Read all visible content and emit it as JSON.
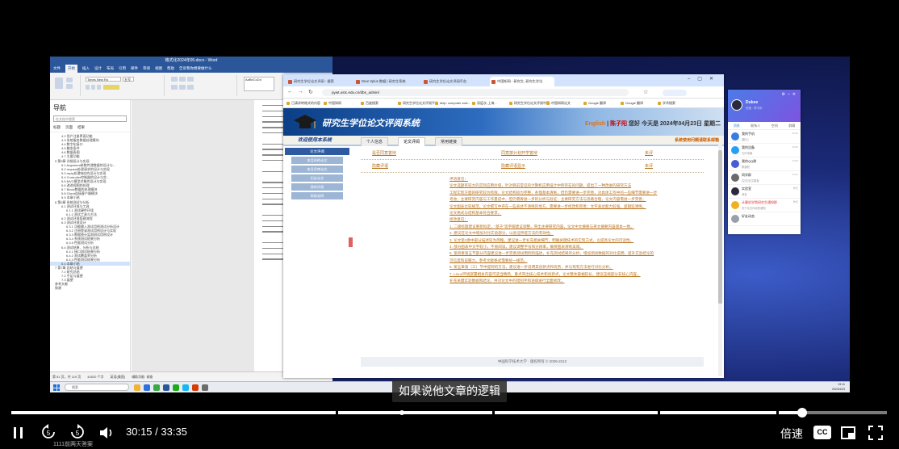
{
  "screen": {
    "word": {
      "title": "格式化2024年05.docx - Word",
      "tabs": [
        "文件",
        "开始",
        "插入",
        "设计",
        "布局",
        "引用",
        "邮件",
        "审阅",
        "视图",
        "帮助",
        "告诉我你想要做什么"
      ],
      "font_name": "Times New Ro",
      "font_size": "五号",
      "style": "AaBbCcDd",
      "nav_title": "导航",
      "nav_search_placeholder": "在文档中搜索",
      "nav_tabs": [
        "标题",
        "页面",
        "结果"
      ],
      "nav_items": [
        "4.2 用户注册界面功能",
        "4.3 系统服务数据处理模块",
        "4.4 数字化接口",
        "4.5 触发条件",
        "4.6 数据表图",
        "4.7 主要功能",
        "5 第5章 详细设计与实现",
        "5.1 Argument参数传递数据的设计与...",
        "5.2 request处理请求的设计与实现",
        "5.3 reply处理响应的设计与实现",
        "5.4 Controller控制器的设计与实...",
        "5.5 MVC模型对象的设计与实现",
        "5.6 改进视图的处理",
        "5.7 Block数据的处理模块",
        "5.8 Client连接客户端模块",
        "5.9 本章小结",
        "6 第6章 系统测试与分析",
        "6.1 测试环境与工具",
        "6.1.1 测试硬件环境",
        "6.1.2 测试工具与方法",
        "6.2 测试环境搭建流程",
        "6.3 测试环境设计",
        "6.3.1 功能输入测试用例测试分析设计",
        "6.3.2 注册登录测试用例设计与实现",
        "6.3.3 数据统计监测测试用例设计",
        "6.3.4 系统测试结果分析",
        "6.3.5 性能测试分析",
        "6.4 测试结果、分析与总结",
        "6.4.1 接口测试结果分析",
        "6.4.2 测试覆盖率分析",
        "6.4.3 性能测试结果分析",
        "6.4 本章小结",
        "7 第7章 总结与展望",
        "7.1 研究总结",
        "7.2 不足与展望",
        "7.3 展望",
        "参考文献",
        "致谢"
      ],
      "nav_selected_index": 31,
      "status": [
        "第 81 页，共 119 页",
        "44520 个字",
        "英语(美国)",
        "辅助功能: 调查"
      ]
    },
    "browser": {
      "tabs": [
        "研究生学位论文评阅 - 搜索",
        "Dear Xplus 数据 | 研究生系统",
        "研究生学位论文评阅平台",
        "中国知网 - 研究生, 研究生学位"
      ],
      "active_tab": 3,
      "url": "pywt.ustc.edu.cn/dbs_admin/",
      "bookmarks": [
        "已请求转格式的内容",
        "中国知网",
        "百度搜索",
        "研究生学位论文评阅平台",
        "dblp: computer scie...",
        "深层次-上海...",
        "研究生学位论文评阅中国...",
        "中国知网论文",
        "Google 翻译",
        "Google 翻译",
        "学术搜索"
      ]
    },
    "site": {
      "title": "研究生学位论文评阅系统",
      "user_lang": "English",
      "user_name": "陈子阳",
      "user_greeting": "您好 今天是 2024年04月23日 星期二",
      "welcome": "欢迎使用本系统",
      "tabs": [
        "个人信息",
        "论文评阅",
        "常用链接"
      ],
      "active_tab": 1,
      "sys_msg": "系统使用问题请联系邮箱",
      "side_head": "论文评阅",
      "side_items": [
        "本月份的论文",
        "本月评审论文",
        "历史论文",
        "我的评阅",
        "帮助说明"
      ],
      "row1": [
        "是否同意答辩",
        "同意按计划开学答辩",
        "未评"
      ],
      "row2": [
        "隐藏评语",
        "隐藏评语显示",
        "未评"
      ],
      "review_lines": [
        "评语意见：",
        "论文选题有较大的实际应用价值，针对目前常见的计算机应用设计中所存在的问题，提出了一种改进的研究方法",
        "工程实现方面的研究较为有限，论文结构较为完整，条理基本清晰，但仍需要进一步完善，对具体工作中的一些细节需要进一步",
        "考虑；主要研究内容与工作量适中，但仍需要进一步的分析与验证；主要研究方法与思路合理，论文内容需进一步完善；",
        "论文图表比较规范，论文撰写中存在一些表述不清晰的地方，需要进一步修改和完善；文字表达能力较强，逻辑较清晰。",
        "论文格式与结构基本符合要求。",
        "修改意见：",
        "1. 二级标题建议重新拟定，“基于”等字眼建议调整，突出主要研究内容，论文中文摘要与英文摘要内容基本一致。",
        "2. 建议在论文中增加对比实验部分，以验证所提方法的有效性。",
        "3. 论文第3章中部分描述较为简略，建议进一步补充相关细节，明确关键技术的实现方式，以提高论文的可读性。",
        "4. 部分图表中文字较小，不易阅读，建议调整字号和分辨率，确保图表清晰美观。",
        "5. 第四章第五节部分内容建议进一步完善测试用例的描述，补充测试结果的分析，增加测试数据的对比说明，提升实验结论的",
        "可信度和说服力。参考文献格式需要统一规范。",
        "6. 第五章第（三）节中提到的方法，建议进一步说明其创新点和优势，并与现有方法进行对比分析。",
        "7. Linux环境部署相关内容可适当精简，重点突出核心技术和创新点，论文整体篇幅较长，建议压缩部分非核心内容，",
        "补充关键实验数据和结论，并对论文中的错别字和语病进行全面修改。"
      ],
      "footer": "中国科学技术大学 · 版权所有 © 2009-2010"
    },
    "qq": {
      "name": "Dubee",
      "status": "在线 · 学习中",
      "tabs": [
        "消息",
        "联系人",
        "空间",
        "群聊"
      ],
      "items": [
        {
          "title": "我的手机",
          "sub": "[图片]",
          "time": "16:42"
        },
        {
          "title": "我的设备",
          "sub": "文件传输",
          "time": "15:05"
        },
        {
          "title": "我的QQ群",
          "sub": "群通知",
          "time": "14:30"
        },
        {
          "title": "同学群",
          "sub": "[文件]论文模板",
          "time": "13:12"
        },
        {
          "title": "实验室",
          "sub": "消息",
          "time": "昨天"
        },
        {
          "title": "计算机学院研究生通知群",
          "sub": "关于论文评阅的通知",
          "time": "昨天"
        },
        {
          "title": "好友动态",
          "sub": "",
          "time": ""
        }
      ]
    },
    "taskbar": {
      "search_placeholder": "搜索",
      "time": "19:11",
      "date": "2024/4/23"
    }
  },
  "player": {
    "subtitle": "如果说他文章的逻辑",
    "current_time": "30:15",
    "duration": "33:35",
    "time_display": "30:15 / 33:35",
    "progress_fraction": 0.9007,
    "speed_label": "倍速",
    "cc_label": "CC",
    "bottom_caption": "1111前两天答案"
  }
}
